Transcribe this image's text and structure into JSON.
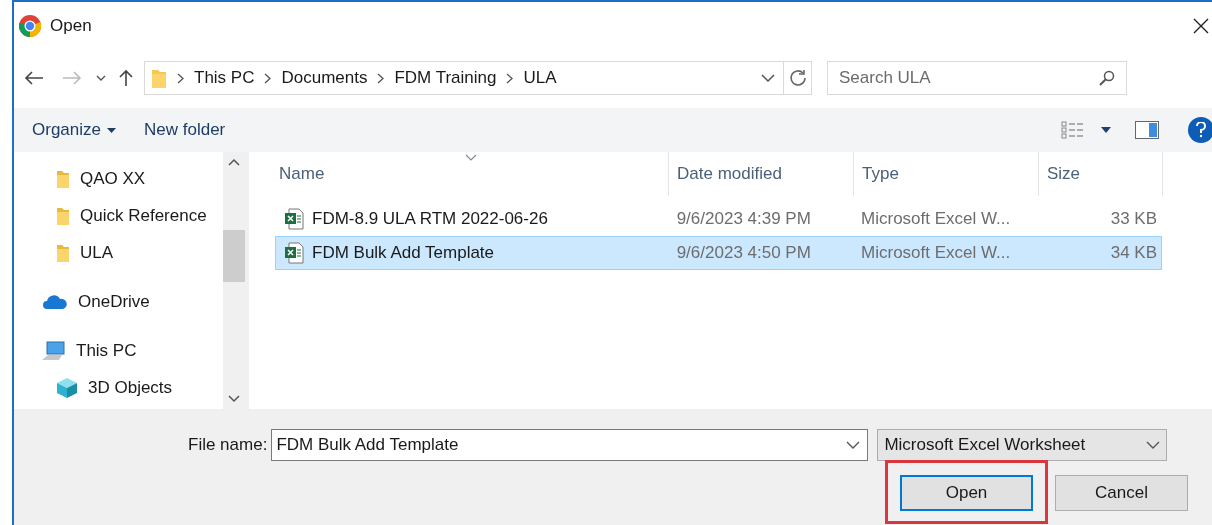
{
  "window": {
    "title": "Open"
  },
  "address_bar": {
    "path": [
      "This PC",
      "Documents",
      "FDM Training",
      "ULA"
    ]
  },
  "search": {
    "placeholder": "Search ULA"
  },
  "toolbar": {
    "buttons": [
      {
        "label": "Organize",
        "kind": "menu"
      },
      {
        "label": "New folder",
        "kind": "plain"
      }
    ]
  },
  "nav_tree": [
    {
      "children": [
        {
          "label": "QAO XX",
          "kind": "folder"
        },
        {
          "label": "Quick Reference",
          "kind": "folder"
        },
        {
          "label": "ULA",
          "kind": "folder"
        }
      ]
    },
    {
      "label": "OneDrive",
      "kind": "cloud"
    },
    {
      "label": "This PC",
      "kind": "computer",
      "children": [
        {
          "label": "3D Objects",
          "kind": "cube"
        }
      ]
    }
  ],
  "table": {
    "columns": [
      "Name",
      "Date modified",
      "Type",
      "Size"
    ],
    "rows": [
      {
        "cells": [
          "FDM-8.9 ULA RTM 2022-06-26",
          "9/6/2023 4:39 PM",
          "Microsoft Excel W...",
          "33 KB"
        ],
        "selected": false
      },
      {
        "cells": [
          "FDM Bulk Add Template",
          "9/6/2023 4:50 PM",
          "Microsoft Excel W...",
          "34 KB"
        ],
        "selected": true
      }
    ]
  },
  "file_name": {
    "label": "File name:",
    "value": "FDM Bulk Add Template"
  },
  "file_type": {
    "value": "Microsoft Excel Worksheet"
  },
  "buttons": [
    {
      "label": "Open",
      "highlighted": true
    },
    {
      "label": "Cancel",
      "highlighted": false
    }
  ]
}
